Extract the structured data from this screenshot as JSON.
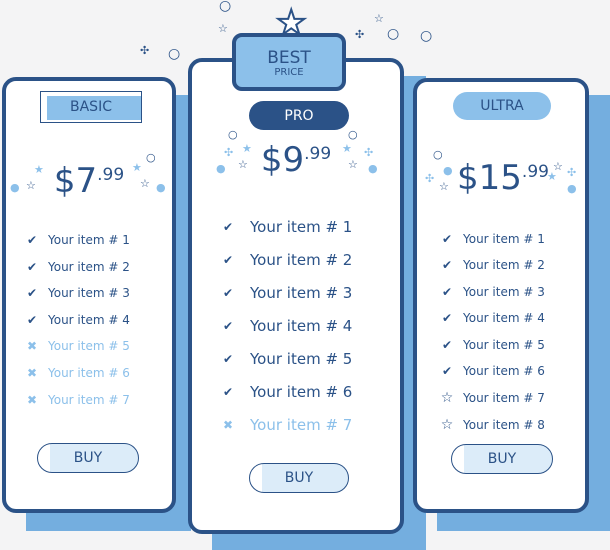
{
  "colors": {
    "navy": "#2b5287",
    "light_blue": "#8cc0ea",
    "shadow_blue": "#74aedf",
    "background": "#f4f4f5"
  },
  "plans": [
    {
      "name": "BASIC",
      "price_main": "$7",
      "price_cents": ".99",
      "buy_label": "BUY",
      "items": [
        {
          "label": "Your item # 1",
          "icon": "check-icon"
        },
        {
          "label": "Your item # 2",
          "icon": "check-icon"
        },
        {
          "label": "Your item # 3",
          "icon": "check-icon"
        },
        {
          "label": "Your item # 4",
          "icon": "check-icon"
        },
        {
          "label": "Your item # 5",
          "icon": "cross-icon"
        },
        {
          "label": "Your item # 6",
          "icon": "cross-icon"
        },
        {
          "label": "Your item # 7",
          "icon": "cross-icon"
        }
      ]
    },
    {
      "name": "PRO",
      "badge_title": "BEST",
      "badge_sub": "PRICE",
      "price_main": "$9",
      "price_cents": ".99",
      "buy_label": "BUY",
      "items": [
        {
          "label": "Your item # 1",
          "icon": "check-icon"
        },
        {
          "label": "Your item # 2",
          "icon": "check-icon"
        },
        {
          "label": "Your item # 3",
          "icon": "check-icon"
        },
        {
          "label": "Your item # 4",
          "icon": "check-icon"
        },
        {
          "label": "Your item # 5",
          "icon": "check-icon"
        },
        {
          "label": "Your item # 6",
          "icon": "check-icon"
        },
        {
          "label": "Your item # 7",
          "icon": "cross-icon"
        }
      ]
    },
    {
      "name": "ULTRA",
      "price_main": "$15",
      "price_cents": ".99",
      "buy_label": "BUY",
      "items": [
        {
          "label": "Your item # 1",
          "icon": "check-icon"
        },
        {
          "label": "Your item # 2",
          "icon": "check-icon"
        },
        {
          "label": "Your item # 3",
          "icon": "check-icon"
        },
        {
          "label": "Your item # 4",
          "icon": "check-icon"
        },
        {
          "label": "Your item # 5",
          "icon": "check-icon"
        },
        {
          "label": "Your item # 6",
          "icon": "check-icon"
        },
        {
          "label": "Your item # 7",
          "icon": "star-icon"
        },
        {
          "label": "Your item # 8",
          "icon": "star-icon"
        }
      ]
    }
  ]
}
